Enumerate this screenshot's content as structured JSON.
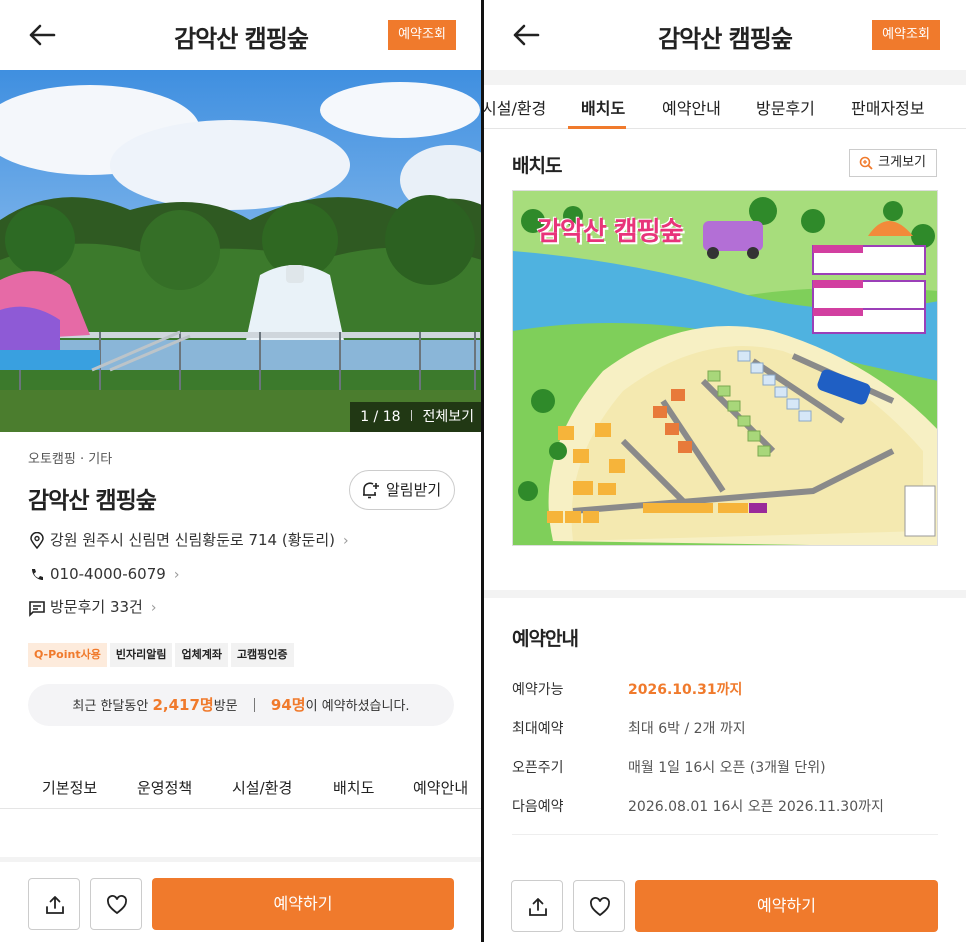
{
  "left": {
    "header": {
      "title": "감악산 캠핑숲",
      "reserve_check": "예약조회"
    },
    "gallery": {
      "current": "1",
      "total": "18",
      "view_all": "전체보기"
    },
    "category": "오토캠핑 · 기타",
    "name": "감악산 캠핑숲",
    "notify_label": "알림받기",
    "address": "강원 원주시 신림면 신림황둔로 714 (황둔리)",
    "phone": "010-4000-6079",
    "reviews": "방문후기 33건",
    "tags": [
      "Q-Point사용",
      "빈자리알림",
      "업체계좌",
      "고캠핑인증"
    ],
    "stats": {
      "prefix": "최근 한달동안",
      "visits": "2,417명",
      "visits_suffix": "방문",
      "bookers": "94명",
      "bookers_suffix": "이 예약하셨습니다."
    },
    "tabs": [
      "기본정보",
      "운영정책",
      "시설/환경",
      "배치도",
      "예약안내"
    ],
    "book_label": "예약하기"
  },
  "right": {
    "header": {
      "title": "감악산 캠핑숲",
      "reserve_check": "예약조회"
    },
    "tabs": [
      "시설/환경",
      "배치도",
      "예약안내",
      "방문후기",
      "판매자정보"
    ],
    "active_tab": "배치도",
    "layout_title": "배치도",
    "enlarge_label": "크게보기",
    "map_title": "감악산 캠핑숲",
    "reservation": {
      "title": "예약안내",
      "rows": [
        {
          "label": "예약가능",
          "value": "2026.10.31까지"
        },
        {
          "label": "최대예약",
          "value": "최대 6박 / 2개 까지"
        },
        {
          "label": "오픈주기",
          "value": "매월 1일  16시 오픈  (3개월 단위)"
        },
        {
          "label": "다음예약",
          "value": "2026.08.01 16시 오픈  2026.11.30까지"
        }
      ]
    },
    "book_label": "예약하기"
  },
  "colors": {
    "accent": "#f07a2c",
    "tag_bg": "#fdebdc",
    "stats_bg": "#f4f4f6"
  }
}
